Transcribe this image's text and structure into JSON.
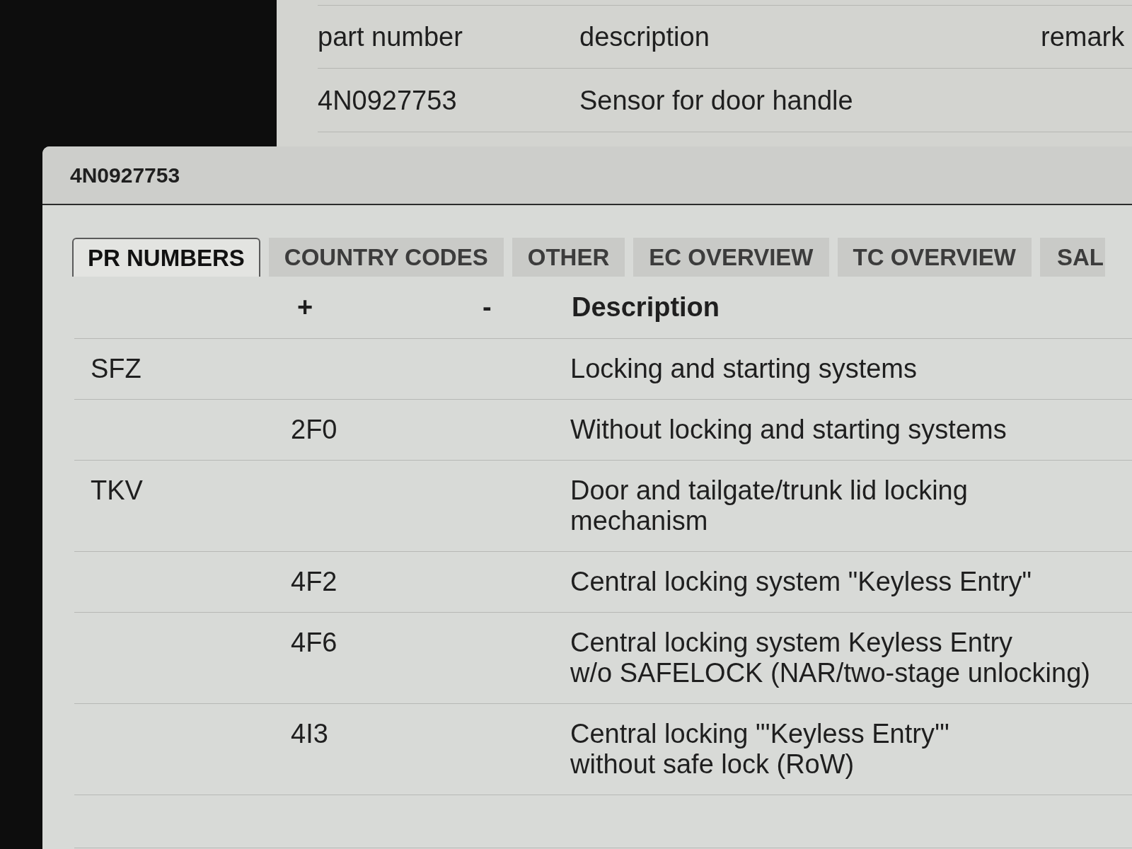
{
  "parts_list": {
    "columns": [
      "part number",
      "description",
      "remark"
    ],
    "rows": [
      {
        "part_number": "4N0927753",
        "description": "Sensor for door handle"
      }
    ]
  },
  "dialog": {
    "title": "4N0927753",
    "tabs": [
      {
        "label": "PR NUMBERS",
        "selected": true
      },
      {
        "label": "COUNTRY CODES",
        "selected": false
      },
      {
        "label": "OTHER",
        "selected": false
      },
      {
        "label": "EC OVERVIEW",
        "selected": false
      },
      {
        "label": "TC OVERVIEW",
        "selected": false
      },
      {
        "label": "SAL",
        "selected": false
      }
    ],
    "table": {
      "columns": {
        "plus": "+",
        "minus": "-",
        "description": "Description"
      },
      "rows": [
        {
          "column_1": "SFZ",
          "description": "Locking and starting systems"
        },
        {
          "plus": "2F0",
          "description": "Without locking and starting systems"
        },
        {
          "column_1": "TKV",
          "description": "Door and tailgate/trunk lid locking\nmechanism"
        },
        {
          "plus": "4F2",
          "description": "Central locking system \"Keyless Entry\""
        },
        {
          "plus": "4F6",
          "description": "Central locking system Keyless Entry\nw/o SAFELOCK (NAR/two-stage unlocking)"
        },
        {
          "plus": "4I3",
          "description": "Central locking \"'Keyless Entry'\"\nwithout safe lock (RoW)"
        }
      ]
    }
  }
}
